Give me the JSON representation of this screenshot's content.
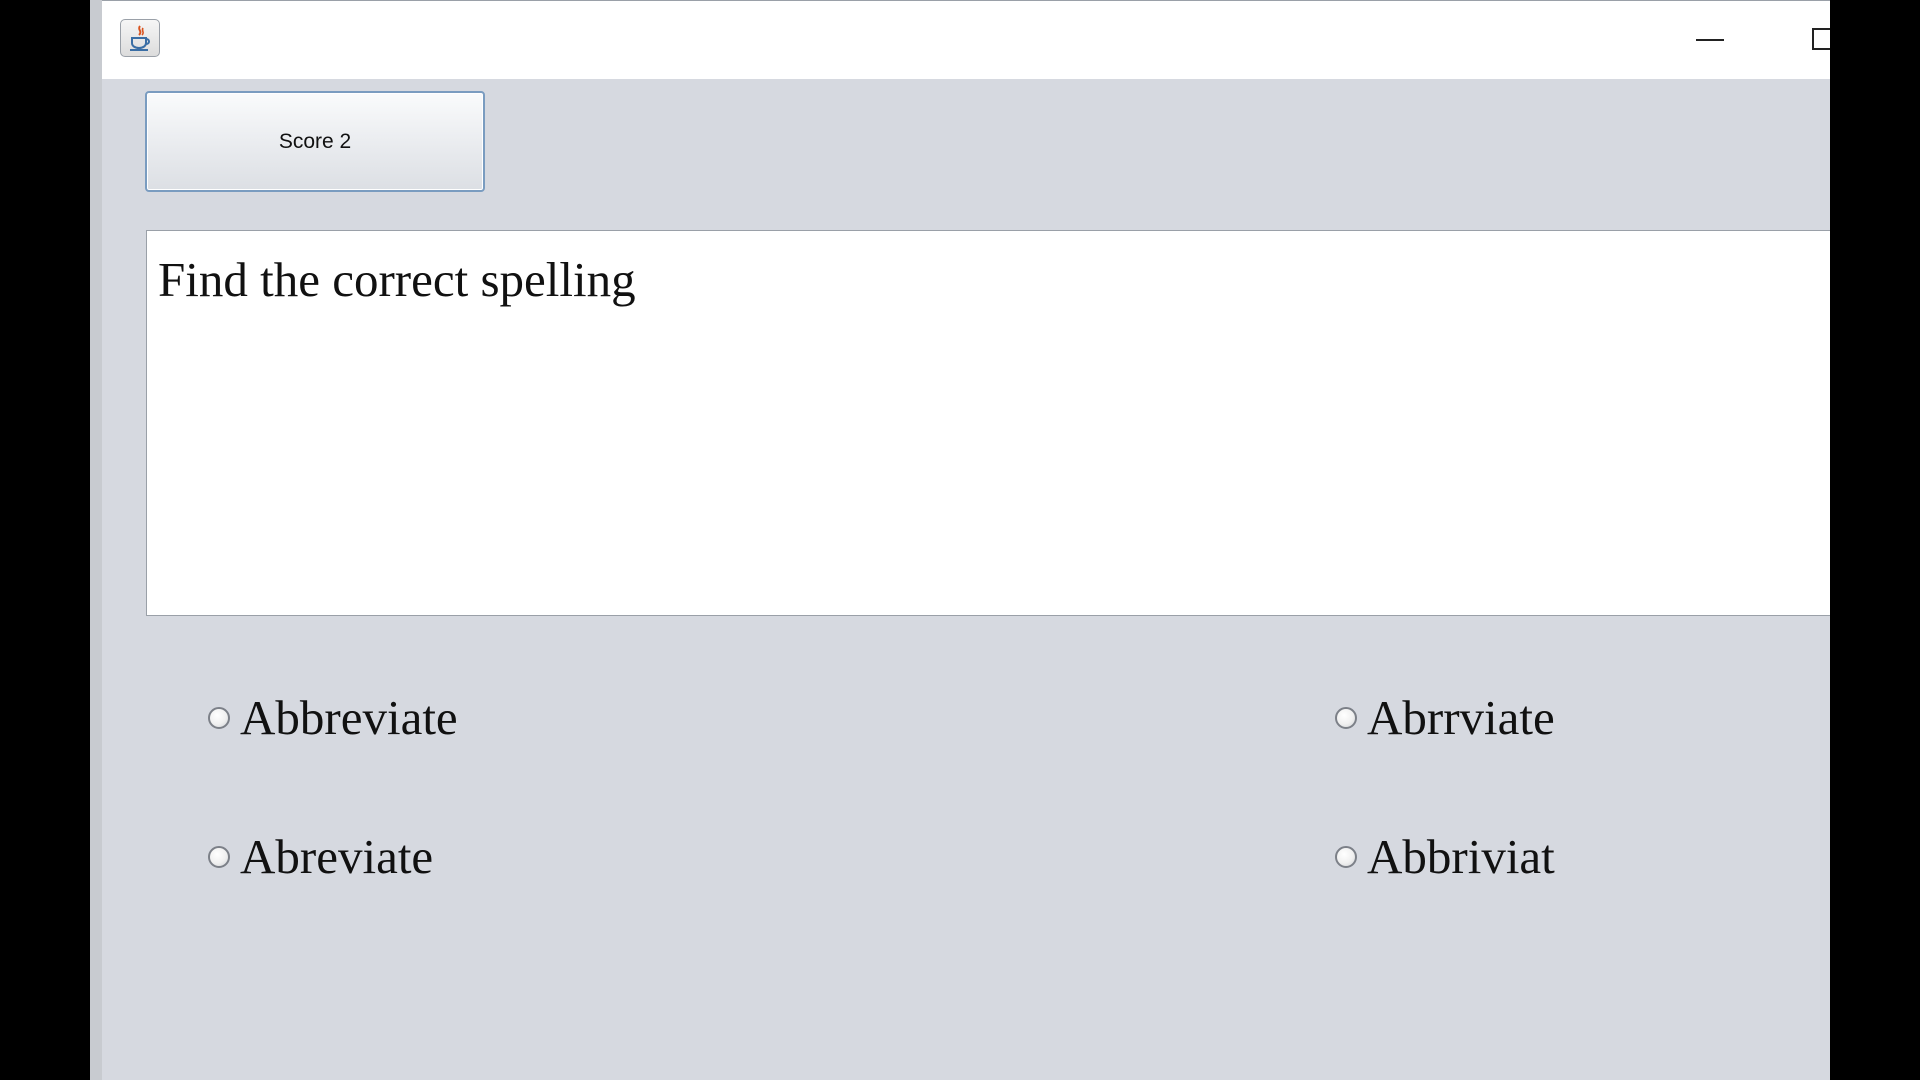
{
  "window": {
    "icon": "java-icon",
    "controls": {
      "minimize_icon": "minimize-icon",
      "maximize_icon": "maximize-icon"
    }
  },
  "score_button": {
    "label": "Score 2"
  },
  "question": {
    "text": "Find the correct spelling"
  },
  "options": [
    {
      "label": "Abbreviate",
      "selected": false
    },
    {
      "label": "Abrrviate",
      "selected": false
    },
    {
      "label": "Abreviate",
      "selected": false
    },
    {
      "label": "Abbriviat",
      "selected": false
    }
  ],
  "colors": {
    "window_bg": "#d6d9e0",
    "titlebar_bg": "#ffffff",
    "button_border": "#7a9cc0",
    "text": "#111111"
  }
}
